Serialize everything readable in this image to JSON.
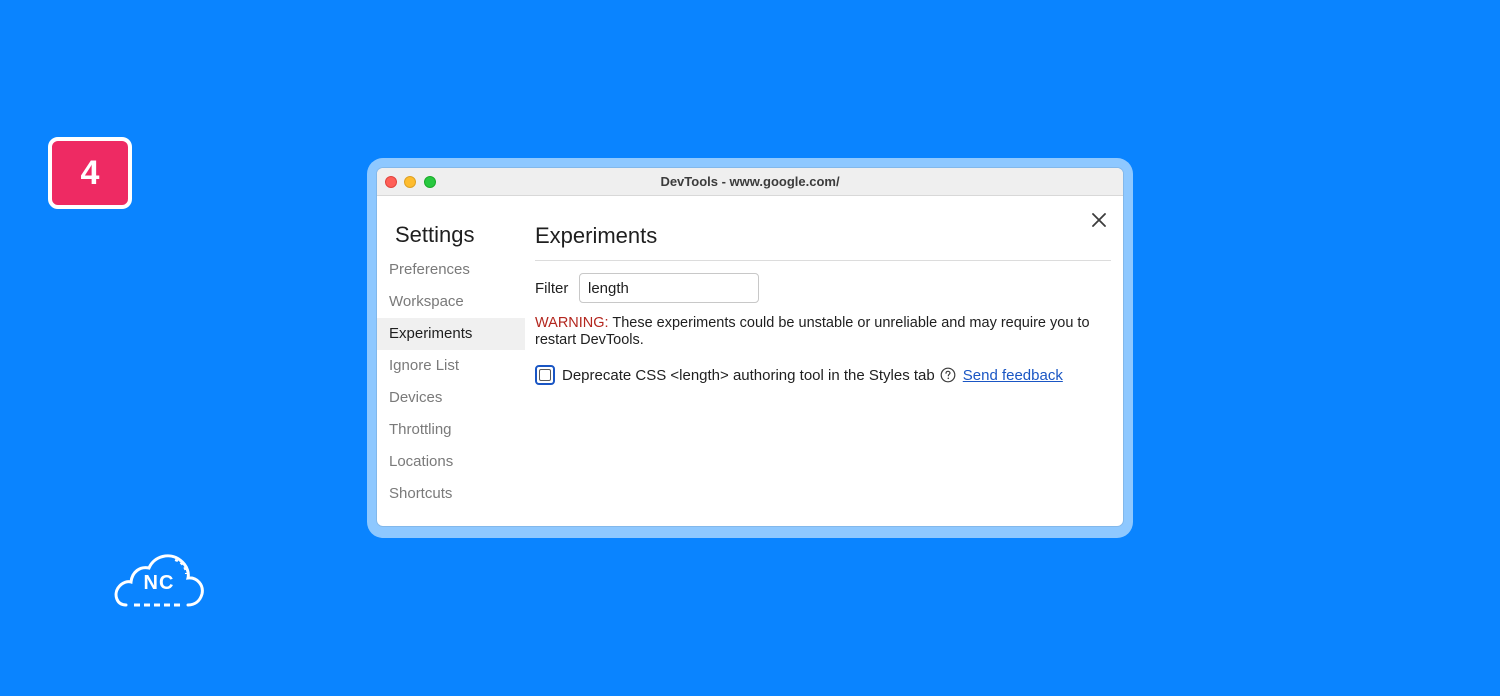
{
  "step_badge": {
    "number": "4",
    "color": "#ee2a63"
  },
  "logo": {
    "text": "NC",
    "icon": "cloud-icon"
  },
  "window": {
    "title": "DevTools - www.google.com/",
    "controls": [
      "close-icon",
      "minimize-icon",
      "maximize-icon"
    ]
  },
  "sidebar": {
    "title": "Settings",
    "items": [
      {
        "label": "Preferences",
        "active": false
      },
      {
        "label": "Workspace",
        "active": false
      },
      {
        "label": "Experiments",
        "active": true
      },
      {
        "label": "Ignore List",
        "active": false
      },
      {
        "label": "Devices",
        "active": false
      },
      {
        "label": "Throttling",
        "active": false
      },
      {
        "label": "Locations",
        "active": false
      },
      {
        "label": "Shortcuts",
        "active": false
      }
    ]
  },
  "panel": {
    "title": "Experiments",
    "close_icon": "close-icon",
    "filter": {
      "label": "Filter",
      "value": "length"
    },
    "warning": {
      "label": "WARNING:",
      "text": " These experiments could be unstable or unreliable and may require you to restart DevTools."
    },
    "experiments": [
      {
        "label": "Deprecate CSS <length> authoring tool in the Styles tab",
        "checked": false,
        "help_icon": "help-icon",
        "link": "Send feedback"
      }
    ]
  },
  "colors": {
    "background": "#0a84ff",
    "link": "#1a56c4",
    "warning": "#b3261e"
  }
}
